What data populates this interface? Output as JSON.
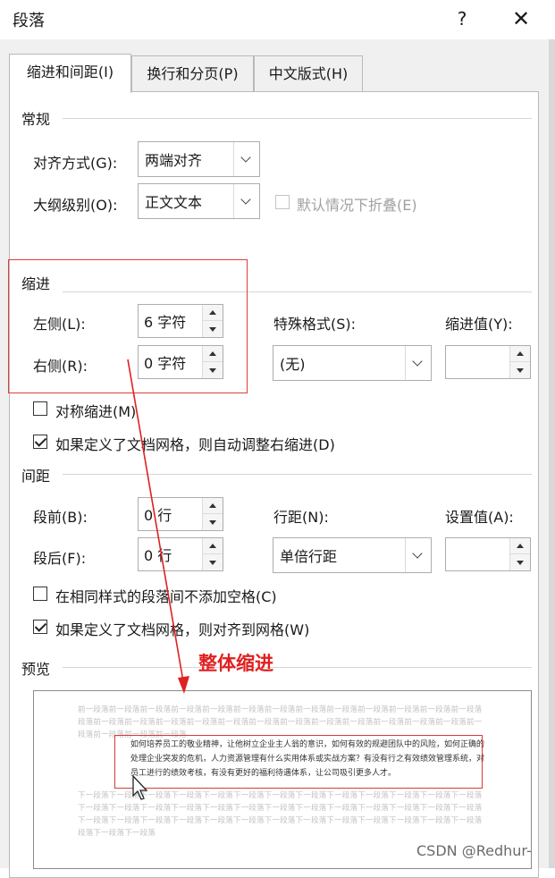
{
  "window": {
    "title": "段落",
    "help_label": "?",
    "close_label": "✕"
  },
  "tabs": [
    {
      "label": "缩进和间距(I)",
      "active": true
    },
    {
      "label": "换行和分页(P)",
      "active": false
    },
    {
      "label": "中文版式(H)",
      "active": false
    }
  ],
  "general": {
    "heading": "常规",
    "alignment_label": "对齐方式(G):",
    "alignment_value": "两端对齐",
    "outline_label": "大纲级别(O):",
    "outline_value": "正文文本",
    "collapse_label": "默认情况下折叠(E)",
    "collapse_checked": false,
    "collapse_enabled": false
  },
  "indent": {
    "heading": "缩进",
    "left_label": "左侧(L):",
    "left_value": "6 字符",
    "right_label": "右侧(R):",
    "right_value": "0 字符",
    "special_label": "特殊格式(S):",
    "special_value": "(无)",
    "by_label": "缩进值(Y):",
    "by_value": "",
    "mirror_label": "对称缩进(M)",
    "mirror_checked": false,
    "auto_adjust_label": "如果定义了文档网格，则自动调整右缩进(D)",
    "auto_adjust_checked": true
  },
  "spacing": {
    "heading": "间距",
    "before_label": "段前(B):",
    "before_value": "0 行",
    "after_label": "段后(F):",
    "after_value": "0 行",
    "line_label": "行距(N):",
    "line_value": "单倍行距",
    "at_label": "设置值(A):",
    "at_value": "",
    "no_space_label": "在相同样式的段落间不添加空格(C)",
    "no_space_checked": false,
    "snap_grid_label": "如果定义了文档网格，则对齐到网格(W)",
    "snap_grid_checked": true
  },
  "preview": {
    "heading": "预览",
    "prev_lines": [
      "前一段落前一段落前一段落前一段落前一段落前一段落前一段落前一段落前一段落前一段落前一段落前一段落前一段落",
      "段落前一段落前一段落前一段落前一段落前一段落前一段落前一段落前一段落前一段落前一段落前一段落前一段落前一",
      "段落前一段落前一段落前一段落"
    ],
    "body_text": "如何培养员工的敬业精神，让他树立企业主人翁的意识，如何有效的规避团队中的风险，如何正确的处理企业突发的危机，人力资源管理有什么实用体系或实战方案？有没有行之有效绩效管理系统，对员工进行的绩效考核，有没有更好的福利待遇体系，让公司吸引更多人才。",
    "next_lines": [
      "下一段落下一段落下一段落下一段落下一段落下一段落下一段落下一段落下一段落下一段落下一段落下一段落下一段落",
      "下一段落下一段落下一段落下一段落下一段落下一段落下一段落下一段落下一段落下一段落下一段落下一段落下一段落",
      "下一段落下一段落下一段落下一段落下一段落下一段落下一段落下一段落下一段落下一段落下一段落下一段落下一段落",
      "段落下一段落下一段落"
    ]
  },
  "annotation": {
    "text": "整体缩进",
    "color": "#e02020"
  },
  "watermark": "CSDN @Redhur-"
}
